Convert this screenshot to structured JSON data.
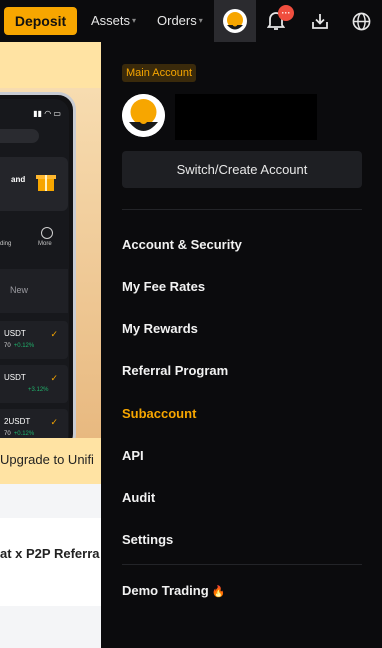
{
  "topbar": {
    "deposit_label": "Deposit",
    "assets_label": "Assets",
    "orders_label": "Orders",
    "caret": "▾",
    "notification_badge": "···"
  },
  "background_page": {
    "phone_card_text": "and",
    "phone_tabs": [
      "ding",
      "More"
    ],
    "phone_new_label": "New",
    "phone_rows": [
      {
        "pair": "USDT",
        "price": "70",
        "change": "+0.12%"
      },
      {
        "pair": "USDT",
        "price": "",
        "change": "+3.12%"
      },
      {
        "pair": "2USDT",
        "price": "70",
        "change": "+0.12%"
      }
    ],
    "check": "✓",
    "upgrade_text": "Upgrade to Unifi",
    "promo_text": "at x P2P Referra"
  },
  "panel": {
    "account_badge": "Main Account",
    "switch_label": "Switch/Create Account",
    "menu": [
      {
        "label": "Account & Security",
        "active": false
      },
      {
        "label": "My Fee Rates",
        "active": false
      },
      {
        "label": "My Rewards",
        "active": false
      },
      {
        "label": "Referral Program",
        "active": false
      },
      {
        "label": "Subaccount",
        "active": true
      },
      {
        "label": "API",
        "active": false
      },
      {
        "label": "Audit",
        "active": false
      },
      {
        "label": "Settings",
        "active": false
      }
    ],
    "demo_label": "Demo Trading",
    "demo_icon": "🔥"
  },
  "colors": {
    "accent": "#f7a600",
    "background": "#0b0b0d",
    "button_bg": "#1e1f23",
    "notification": "#f04e3e"
  },
  "icons": [
    "avatar-icon",
    "bell-icon",
    "download-icon",
    "globe-icon",
    "fire-icon"
  ]
}
